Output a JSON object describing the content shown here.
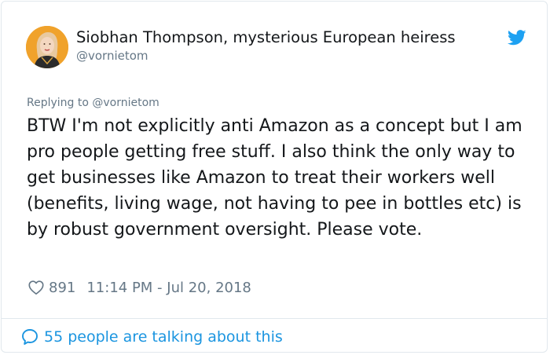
{
  "author": {
    "display_name": "Siobhan Thompson, mysterious European heiress",
    "handle": "@vornietom",
    "avatar_icon": "user-avatar",
    "verified_icon": "twitter-bird-icon"
  },
  "tweet": {
    "replying_to": "Replying to @vornietom",
    "text": "BTW I'm not explicitly anti Amazon as a concept but I am pro people getting free stuff. I also think the only way to get businesses like Amazon to treat their workers well (benefits, living wage, not having to pee in bottles etc) is by robust government oversight. Please vote.",
    "likes": "891",
    "timestamp": "11:14 PM - Jul 20, 2018"
  },
  "footer": {
    "conversation_label": "55 people are talking about this"
  },
  "colors": {
    "text": "#14171a",
    "muted": "#657786",
    "accent": "#1b95e0",
    "twitter_blue": "#1da1f2",
    "border": "#e1e8ed",
    "avatar_bg": "#f0a22b"
  }
}
